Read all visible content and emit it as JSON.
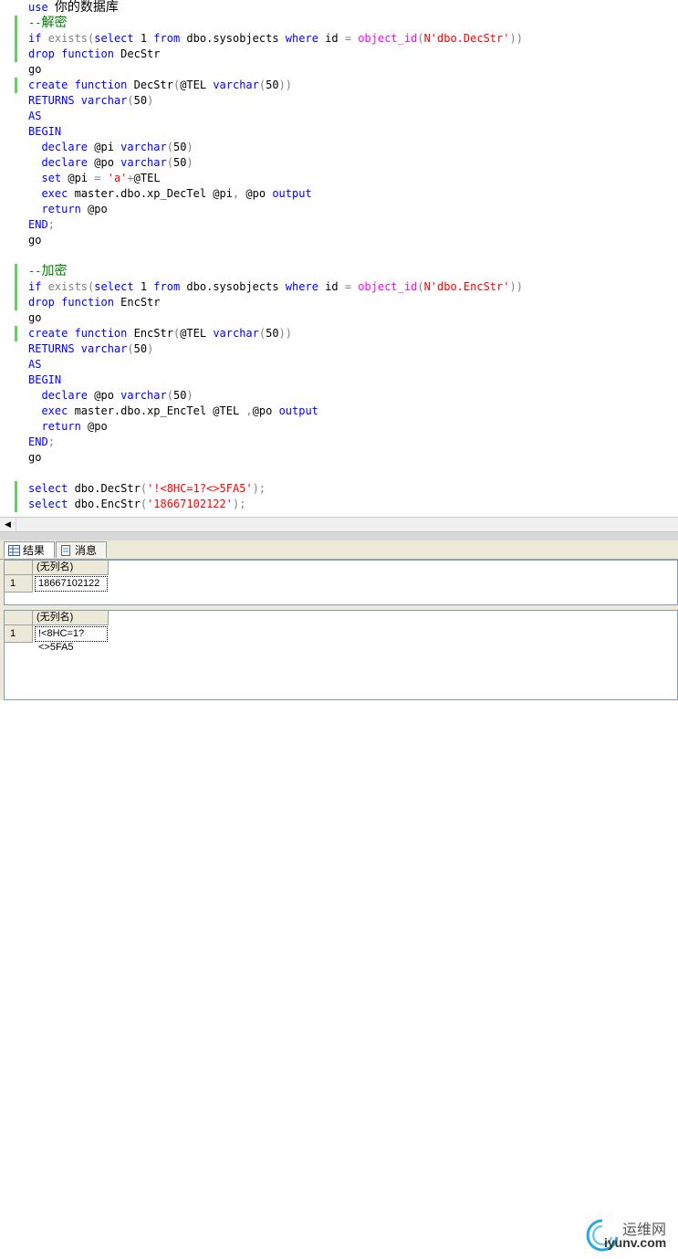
{
  "editor": {
    "lines": [
      [
        [
          "kw",
          "use "
        ],
        [
          "cjk",
          "你的数据库"
        ]
      ],
      [
        [
          "cm",
          "--"
        ],
        [
          "cmcjk",
          "解密"
        ]
      ],
      [
        [
          "kw",
          "if "
        ],
        [
          "gr",
          "exists("
        ],
        [
          "kw",
          "select "
        ],
        [
          "",
          "1 "
        ],
        [
          "kw",
          "from "
        ],
        [
          "",
          "dbo.sysobjects "
        ],
        [
          "kw",
          "where "
        ],
        [
          "",
          "id "
        ],
        [
          "gr",
          "= "
        ],
        [
          "fn",
          "object_id"
        ],
        [
          "gr",
          "("
        ],
        [
          "st",
          "N'dbo.DecStr'"
        ],
        [
          "gr",
          "))"
        ]
      ],
      [
        [
          "kw",
          "drop function "
        ],
        [
          "",
          "DecStr"
        ]
      ],
      [
        [
          "",
          "go"
        ]
      ],
      [
        [
          "kw",
          "create function "
        ],
        [
          "",
          "DecStr"
        ],
        [
          "gr",
          "("
        ],
        [
          "",
          "@TEL "
        ],
        [
          "kw",
          "varchar"
        ],
        [
          "gr",
          "("
        ],
        [
          "",
          "50"
        ],
        [
          "gr",
          "))"
        ]
      ],
      [
        [
          "kw",
          "RETURNS varchar"
        ],
        [
          "gr",
          "("
        ],
        [
          "",
          "50"
        ],
        [
          "gr",
          ")"
        ]
      ],
      [
        [
          "kw",
          "AS"
        ]
      ],
      [
        [
          "kw",
          "BEGIN"
        ]
      ],
      [
        [
          "",
          "  "
        ],
        [
          "kw",
          "declare "
        ],
        [
          "",
          "@pi "
        ],
        [
          "kw",
          "varchar"
        ],
        [
          "gr",
          "("
        ],
        [
          "",
          "50"
        ],
        [
          "gr",
          ")"
        ]
      ],
      [
        [
          "",
          "  "
        ],
        [
          "kw",
          "declare "
        ],
        [
          "",
          "@po "
        ],
        [
          "kw",
          "varchar"
        ],
        [
          "gr",
          "("
        ],
        [
          "",
          "50"
        ],
        [
          "gr",
          ")"
        ]
      ],
      [
        [
          "",
          "  "
        ],
        [
          "kw",
          "set "
        ],
        [
          "",
          "@pi "
        ],
        [
          "gr",
          "= "
        ],
        [
          "st",
          "'a'"
        ],
        [
          "gr",
          "+"
        ],
        [
          "",
          "@TEL"
        ]
      ],
      [
        [
          "",
          "  "
        ],
        [
          "kw",
          "exec "
        ],
        [
          "",
          "master.dbo.xp_DecTel @pi"
        ],
        [
          "gr",
          ", "
        ],
        [
          "",
          "@po "
        ],
        [
          "kw",
          "output"
        ]
      ],
      [
        [
          "",
          "  "
        ],
        [
          "kw",
          "return "
        ],
        [
          "",
          "@po"
        ]
      ],
      [
        [
          "kw",
          "END"
        ],
        [
          "gr",
          ";"
        ]
      ],
      [
        [
          "",
          "go"
        ]
      ],
      [
        [
          "",
          ""
        ]
      ],
      [
        [
          "cm",
          "--"
        ],
        [
          "cmcjk",
          "加密"
        ]
      ],
      [
        [
          "kw",
          "if "
        ],
        [
          "gr",
          "exists("
        ],
        [
          "kw",
          "select "
        ],
        [
          "",
          "1 "
        ],
        [
          "kw",
          "from "
        ],
        [
          "",
          "dbo.sysobjects "
        ],
        [
          "kw",
          "where "
        ],
        [
          "",
          "id "
        ],
        [
          "gr",
          "= "
        ],
        [
          "fn",
          "object_id"
        ],
        [
          "gr",
          "("
        ],
        [
          "st",
          "N'dbo.EncStr'"
        ],
        [
          "gr",
          "))"
        ]
      ],
      [
        [
          "kw",
          "drop function "
        ],
        [
          "",
          "EncStr"
        ]
      ],
      [
        [
          "",
          "go"
        ]
      ],
      [
        [
          "kw",
          "create function "
        ],
        [
          "",
          "EncStr"
        ],
        [
          "gr",
          "("
        ],
        [
          "",
          "@TEL "
        ],
        [
          "kw",
          "varchar"
        ],
        [
          "gr",
          "("
        ],
        [
          "",
          "50"
        ],
        [
          "gr",
          "))"
        ]
      ],
      [
        [
          "kw",
          "RETURNS varchar"
        ],
        [
          "gr",
          "("
        ],
        [
          "",
          "50"
        ],
        [
          "gr",
          ")"
        ]
      ],
      [
        [
          "kw",
          "AS"
        ]
      ],
      [
        [
          "kw",
          "BEGIN"
        ]
      ],
      [
        [
          "",
          "  "
        ],
        [
          "kw",
          "declare "
        ],
        [
          "",
          "@po "
        ],
        [
          "kw",
          "varchar"
        ],
        [
          "gr",
          "("
        ],
        [
          "",
          "50"
        ],
        [
          "gr",
          ")"
        ]
      ],
      [
        [
          "",
          "  "
        ],
        [
          "kw",
          "exec "
        ],
        [
          "",
          "master.dbo.xp_EncTel @TEL "
        ],
        [
          "gr",
          ","
        ],
        [
          "",
          "@po "
        ],
        [
          "kw",
          "output"
        ]
      ],
      [
        [
          "",
          "  "
        ],
        [
          "kw",
          "return "
        ],
        [
          "",
          "@po"
        ]
      ],
      [
        [
          "kw",
          "END"
        ],
        [
          "gr",
          ";"
        ]
      ],
      [
        [
          "",
          "go"
        ]
      ],
      [
        [
          "",
          ""
        ]
      ],
      [
        [
          "kw",
          "select "
        ],
        [
          "",
          "dbo.DecStr"
        ],
        [
          "gr",
          "("
        ],
        [
          "st",
          "'!<8HC=1?<>5FA5'"
        ],
        [
          "gr",
          ");"
        ]
      ],
      [
        [
          "kw",
          "select "
        ],
        [
          "",
          "dbo.EncStr"
        ],
        [
          "gr",
          "("
        ],
        [
          "st",
          "'18667102122'"
        ],
        [
          "gr",
          ");"
        ]
      ]
    ]
  },
  "tabs": [
    {
      "label": "结果",
      "icon": "grid-icon"
    },
    {
      "label": "消息",
      "icon": "message-icon"
    }
  ],
  "results": [
    {
      "column": "(无列名)",
      "row_number": "1",
      "value": "18667102122"
    },
    {
      "column": "(无列名)",
      "row_number": "1",
      "value": "!<8HC=1?<>5FA5"
    }
  ],
  "watermark": {
    "brand": "运维网",
    "url": "iyunv.com"
  },
  "colors": {
    "keyword": "#0000ff",
    "operator": "#808080",
    "function": "#ff00ff",
    "string": "#ff0000",
    "comment": "#008000",
    "change_marker": "#5fd35f"
  }
}
